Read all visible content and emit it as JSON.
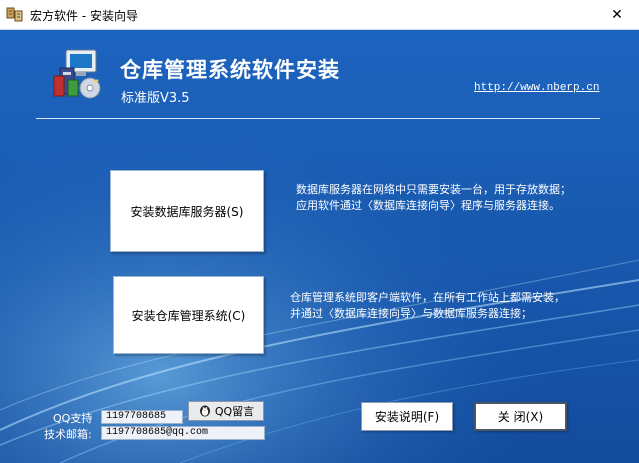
{
  "window": {
    "title": "宏方软件 - 安装向导",
    "close_glyph": "✕"
  },
  "header": {
    "title": "仓库管理系统软件安装",
    "edition": "标准版V3.5",
    "url": "http://www.nberp.cn"
  },
  "actions": [
    {
      "label": "安装数据库服务器(S)",
      "description_line1": "数据库服务器在网络中只需要安装一台，用于存放数据；",
      "description_line2": "应用软件通过〈数据库连接向导〉程序与服务器连接。"
    },
    {
      "label": "安装仓库管理系统(C)",
      "description_line1": "仓库管理系统即客户端软件，在所有工作站上都需安装，",
      "description_line2": "并通过〈数据库连接向导〉与数据库服务器连接；"
    }
  ],
  "support": {
    "qq_label": "QQ支持",
    "qq_value": "1197708685",
    "qq_message_label": "QQ留言",
    "email_label": "技术邮箱:",
    "email_value": "1197708685@qq.com"
  },
  "footer": {
    "help_label": "安装说明(F)",
    "close_label": "关 闭(X)"
  },
  "colors": {
    "background": "#1b5eb6",
    "text_on_blue": "#ffffff"
  }
}
